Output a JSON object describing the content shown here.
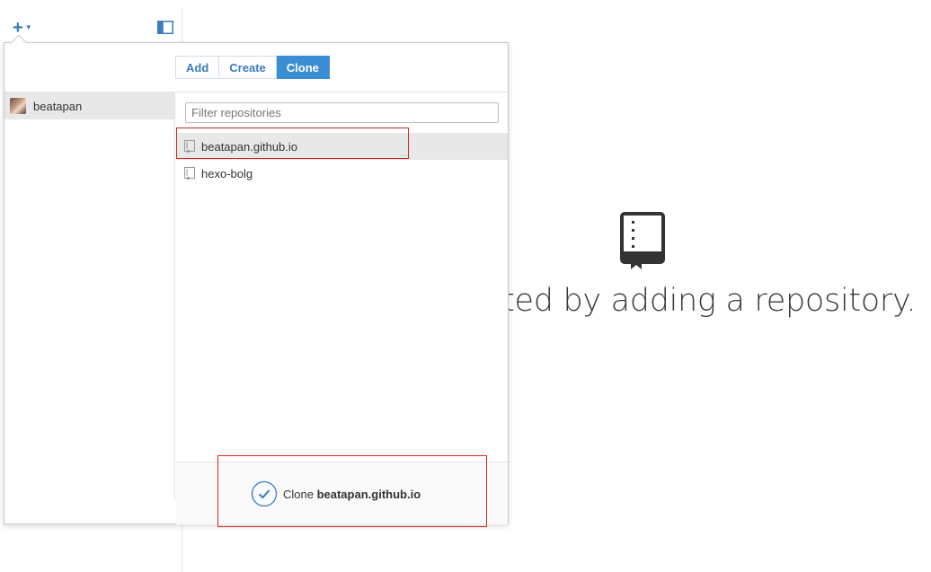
{
  "toolbar": {
    "add_icon": "plus-icon",
    "toggle_icon": "sidebar-toggle-icon"
  },
  "empty_state": {
    "icon": "repository-icon",
    "text": "rted by adding a repository."
  },
  "popover": {
    "tabs": [
      {
        "label": "Add",
        "active": false
      },
      {
        "label": "Create",
        "active": false
      },
      {
        "label": "Clone",
        "active": true
      }
    ],
    "accounts": [
      {
        "label": "beatapan",
        "selected": true
      }
    ],
    "filter": {
      "placeholder": "Filter repositories",
      "value": ""
    },
    "repos": [
      {
        "label": "beatapan.github.io",
        "selected": true
      },
      {
        "label": "hexo-bolg",
        "selected": false
      }
    ],
    "action": {
      "prefix": "Clone ",
      "target": "beatapan.github.io"
    }
  },
  "colors": {
    "accent": "#3b8ed3",
    "link": "#3a7cc0",
    "annotation": "#d0281e"
  }
}
